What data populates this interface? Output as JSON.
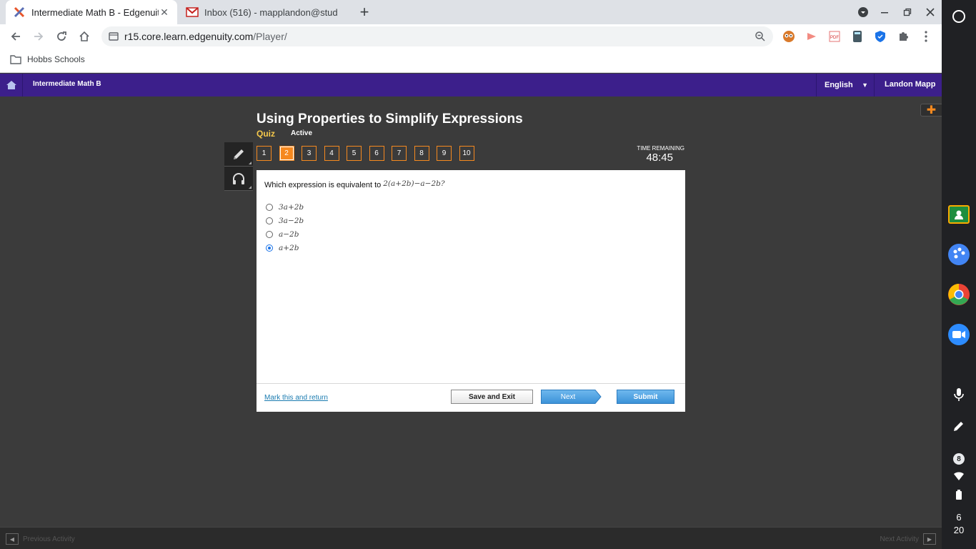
{
  "browser": {
    "tabs": [
      {
        "title": "Intermediate Math B - Edgenuity",
        "active": true
      },
      {
        "title": "Inbox (516) - mapplandon@stud",
        "active": false
      }
    ],
    "url_host": "r15.core.learn.edgenuity.com",
    "url_path": "/Player/",
    "bookmark": "Hobbs Schools"
  },
  "nav": {
    "course": "Intermediate Math B",
    "language": "English",
    "user": "Landon Mapp"
  },
  "lesson": {
    "title": "Using Properties to Simplify Expressions",
    "type": "Quiz",
    "status": "Active"
  },
  "questions": [
    "1",
    "2",
    "3",
    "4",
    "5",
    "6",
    "7",
    "8",
    "9",
    "10"
  ],
  "current_question": "2",
  "timer": {
    "label": "TIME REMAINING",
    "value": "48:45"
  },
  "question": {
    "text": "Which expression is equivalent to",
    "expression": "2(a+2b)−a−2b?",
    "options": [
      {
        "label": "3a+2b",
        "selected": false
      },
      {
        "label": "3a−2b",
        "selected": false
      },
      {
        "label": "a−2b",
        "selected": false
      },
      {
        "label": "a+2b",
        "selected": true
      }
    ]
  },
  "footer": {
    "mark": "Mark this and return",
    "save": "Save and Exit",
    "next": "Next",
    "submit": "Submit"
  },
  "bottom": {
    "prev": "Previous Activity",
    "next": "Next Activity"
  },
  "shelf": {
    "notification_count": "8",
    "time_hour": "6",
    "time_minute": "20"
  },
  "colors": {
    "nav_purple": "#3c1f8b",
    "accent_orange": "#f6891f",
    "quiz_yellow": "#f5c84b",
    "button_blue": "#3b92d8"
  }
}
